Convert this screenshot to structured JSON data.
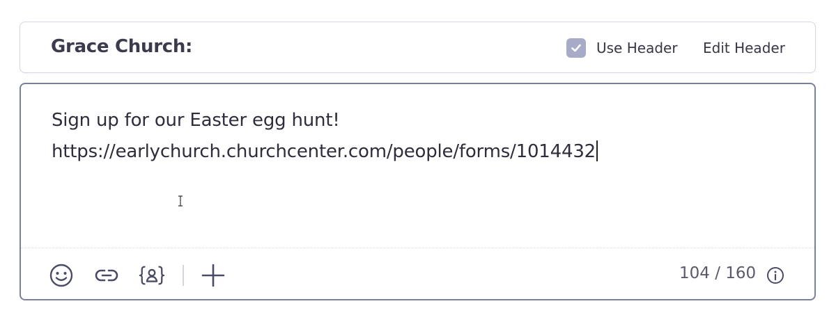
{
  "header": {
    "title": "Grace Church:",
    "use_header_label": "Use Header",
    "use_header_checked": true,
    "edit_header_label": "Edit Header"
  },
  "editor": {
    "line1": "Sign up for our Easter egg hunt!",
    "line2": "https://earlychurch.churchcenter.com/people/forms/1014432"
  },
  "toolbar": {
    "icons": [
      "emoji-icon",
      "link-icon",
      "personalize-variable-icon",
      "plus-icon"
    ],
    "char_count": "104 / 160",
    "info_icon": "info-icon"
  },
  "colors": {
    "checkbox": "#a7abc8",
    "editor_border": "#7a7f9a",
    "header_border": "#d6d7e0",
    "icon": "#4a4c66"
  }
}
